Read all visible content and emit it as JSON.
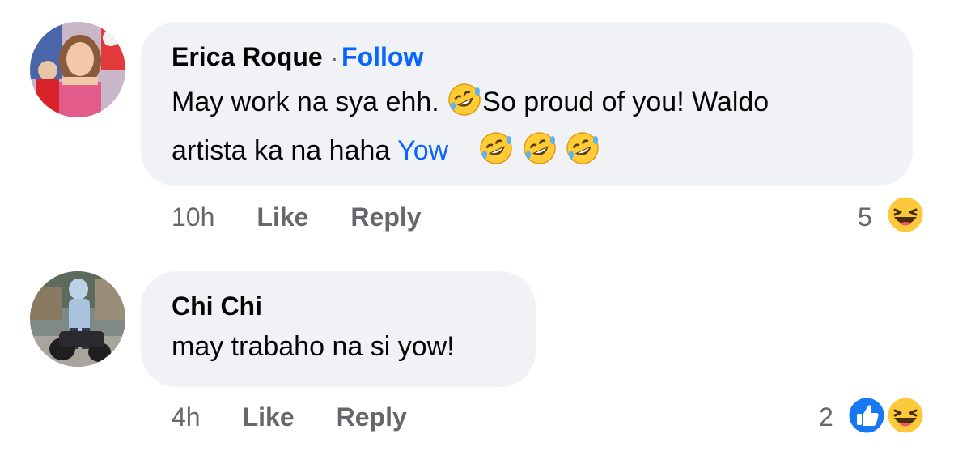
{
  "comments": [
    {
      "author": "Erica Roque",
      "separator": "·",
      "follow_label": "Follow",
      "line1_text": "May work na sya ehh.",
      "line1_text_after_emoji": "So proud of you! Waldo",
      "line2_text": "artista ka na haha",
      "mention": "Yow",
      "time": "10h",
      "like_label": "Like",
      "reply_label": "Reply",
      "reaction_count": "5",
      "reaction_icons": [
        "haha-reaction-icon"
      ]
    },
    {
      "author": "Chi Chi",
      "text": "may trabaho na si yow!",
      "time": "4h",
      "like_label": "Like",
      "reply_label": "Reply",
      "reaction_count": "2",
      "reaction_icons": [
        "like-reaction-icon",
        "haha-reaction-icon"
      ]
    }
  ],
  "colors": {
    "bubble": "#f0f2f5",
    "link_blue": "#0866ff",
    "meta_gray": "#65676b",
    "text": "#050505"
  }
}
